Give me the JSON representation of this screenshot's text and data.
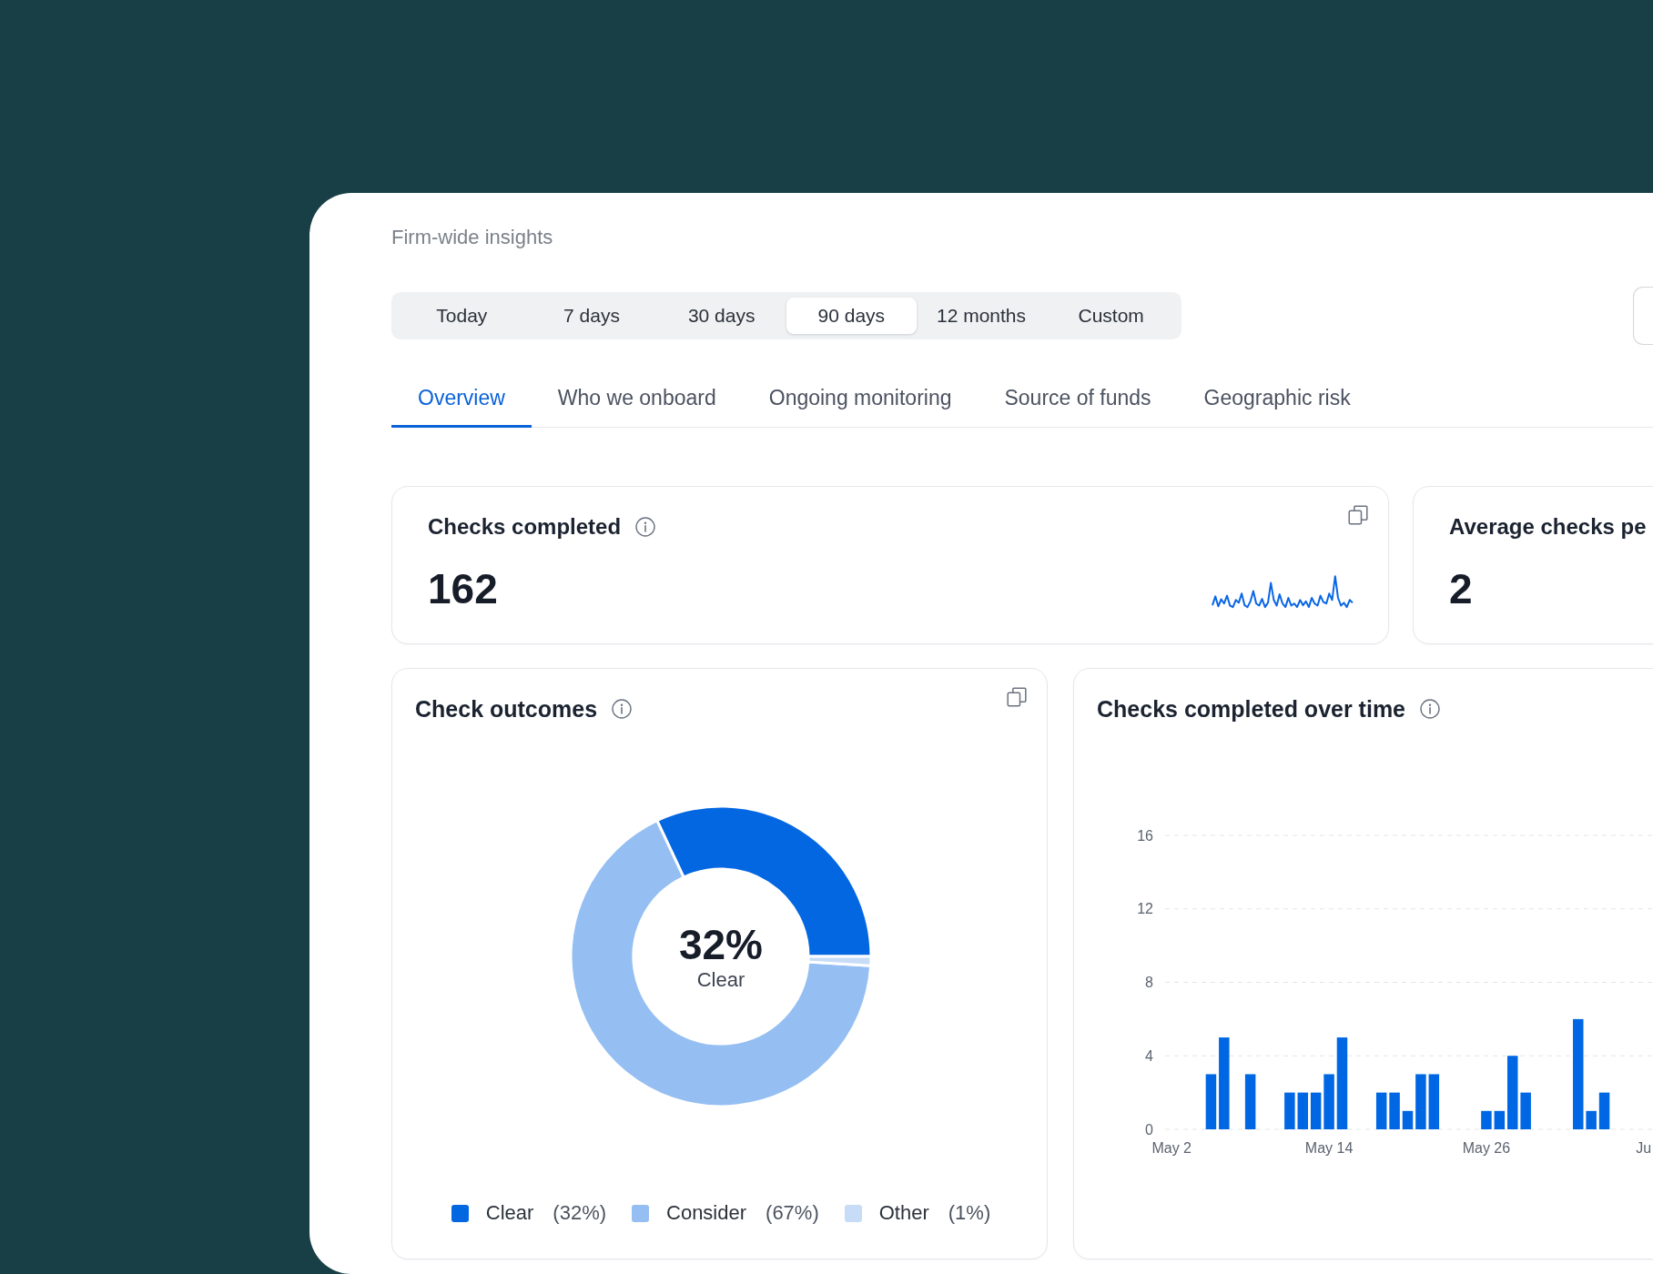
{
  "panel": {
    "title": "Firm-wide insights"
  },
  "period_tabs": [
    {
      "label": "Today",
      "selected": false
    },
    {
      "label": "7 days",
      "selected": false
    },
    {
      "label": "30 days",
      "selected": false
    },
    {
      "label": "90 days",
      "selected": true
    },
    {
      "label": "12 months",
      "selected": false
    },
    {
      "label": "Custom",
      "selected": false
    }
  ],
  "section_tabs": [
    {
      "label": "Overview",
      "selected": true
    },
    {
      "label": "Who we onboard",
      "selected": false
    },
    {
      "label": "Ongoing monitoring",
      "selected": false
    },
    {
      "label": "Source of funds",
      "selected": false
    },
    {
      "label": "Geographic risk",
      "selected": false
    }
  ],
  "stat_cards": [
    {
      "title": "Checks completed",
      "value": "162",
      "info": true,
      "copy": true,
      "sparkline": true
    },
    {
      "title": "Average checks pe",
      "value": "2",
      "info": false,
      "copy": false,
      "sparkline": false
    }
  ],
  "outcomes_card": {
    "title": "Check outcomes",
    "info": true,
    "copy": true,
    "center_value": "32%",
    "center_label": "Clear",
    "chart_data": {
      "type": "donut",
      "categories": [
        "Clear",
        "Consider",
        "Other"
      ],
      "values": [
        32,
        67,
        1
      ],
      "colors": [
        "#0467e2",
        "#95bff2",
        "#c6dcf7"
      ],
      "value_labels": [
        "(32%)",
        "(67%)",
        "(1%)"
      ]
    }
  },
  "timeline_card": {
    "title": "Checks completed over time",
    "info": true,
    "copy": false,
    "chart_data": {
      "type": "bar",
      "categories": [
        "May 2",
        null,
        null,
        null,
        null,
        null,
        null,
        null,
        null,
        null,
        null,
        null,
        "May 14",
        null,
        null,
        null,
        null,
        null,
        null,
        null,
        null,
        null,
        null,
        null,
        "May 26",
        null,
        null,
        null,
        null,
        null,
        null,
        null,
        null,
        null,
        null,
        null,
        "Ju"
      ],
      "values": [
        null,
        null,
        null,
        3,
        5,
        null,
        3,
        null,
        null,
        2,
        2,
        2,
        3,
        5,
        null,
        null,
        2,
        2,
        1,
        3,
        3,
        null,
        null,
        null,
        1,
        1,
        4,
        2,
        null,
        null,
        null,
        6,
        1,
        2,
        null,
        null,
        null
      ],
      "ylim": [
        0,
        16
      ],
      "yticks": [
        0,
        4,
        8,
        12,
        16
      ],
      "grid": true
    }
  }
}
